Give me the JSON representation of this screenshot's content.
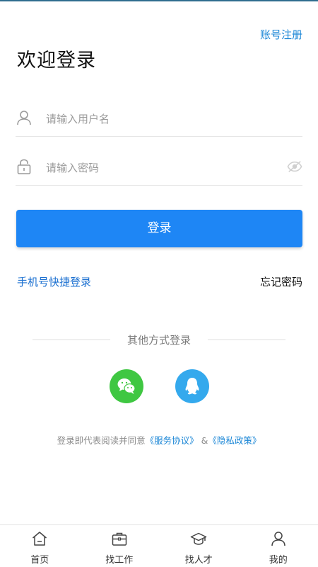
{
  "header": {
    "register_link": "账号注册",
    "title": "欢迎登录"
  },
  "form": {
    "username_placeholder": "请输入用户名",
    "password_placeholder": "请输入密码",
    "login_button": "登录"
  },
  "links": {
    "quick_login": "手机号快捷登录",
    "forgot_password": "忘记密码"
  },
  "other_login": {
    "label": "其他方式登录",
    "methods": [
      {
        "icon": "wechat-icon",
        "color": "#3fc742"
      },
      {
        "icon": "qq-icon",
        "color": "#34a9ed"
      }
    ]
  },
  "agreement": {
    "prefix": "登录即代表阅读并同意",
    "service": "《服务协议》",
    "joiner": " &",
    "privacy": "《隐私政策》"
  },
  "tabbar": {
    "items": [
      {
        "label": "首页",
        "icon": "home-icon"
      },
      {
        "label": "找工作",
        "icon": "briefcase-icon"
      },
      {
        "label": "找人才",
        "icon": "graduation-cap-icon"
      },
      {
        "label": "我的",
        "icon": "user-icon"
      }
    ]
  },
  "colors": {
    "accent": "#1e86f5",
    "link": "#1a86d6"
  }
}
